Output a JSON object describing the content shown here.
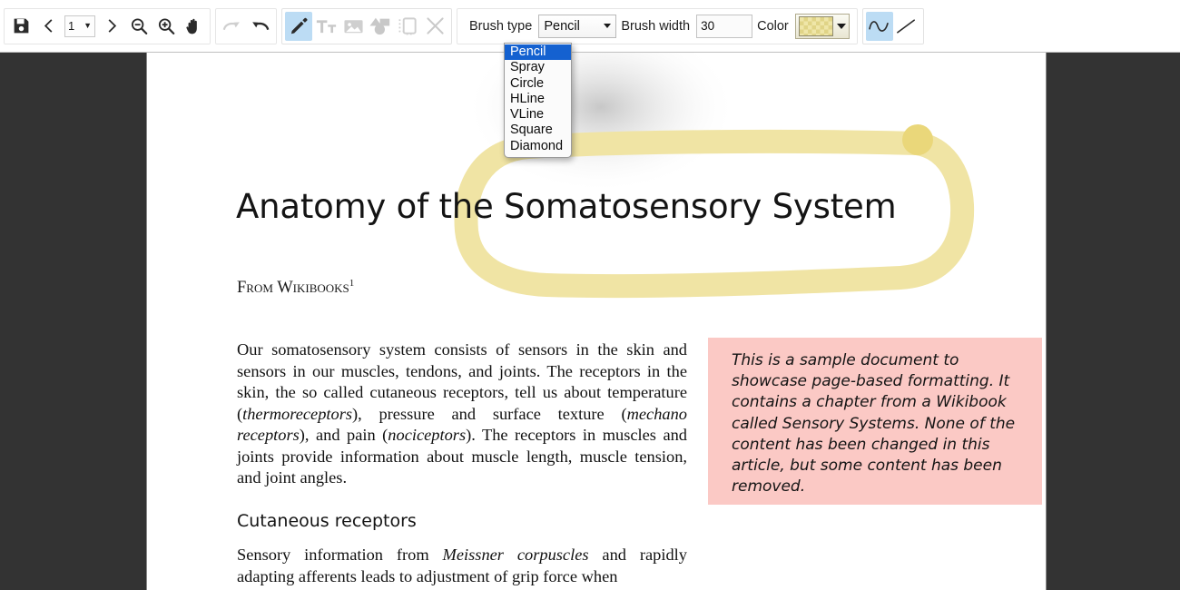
{
  "toolbar": {
    "nav_group": {
      "save_label": "Save",
      "prev_label": "Previous page",
      "page_value": "1",
      "next_label": "Next page",
      "zoom_out_label": "Zoom out",
      "zoom_in_label": "Zoom in",
      "pan_label": "Pan"
    },
    "history_group": {
      "redo_label": "Redo",
      "undo_label": "Undo"
    },
    "tools_group": {
      "pencil_label": "Pencil",
      "text_label": "Text",
      "image_label": "Image",
      "shapes_label": "Shapes",
      "stamp_label": "Stamp",
      "delete_label": "Delete"
    },
    "brush_type_label": "Brush type",
    "brush_type_value": "Pencil",
    "brush_width_label": "Brush width",
    "brush_width_value": "30",
    "color_label": "Color",
    "color_value": "#efe6a8",
    "style_group": {
      "curve_label": "Curve",
      "line_label": "Line"
    }
  },
  "brush_menu": {
    "open": true,
    "selected": "Pencil",
    "options": [
      "Pencil",
      "Spray",
      "Circle",
      "HLine",
      "VLine",
      "Square",
      "Diamond"
    ]
  },
  "document": {
    "title": "Anatomy of the Somatosensory System",
    "source_line": "From Wikibooks",
    "source_footnote": "1",
    "paragraph1_html": "Our somatosensory system consists of sensors in the skin and sensors in our muscles, tendons, and joints. The receptors in the skin, the so called cutaneous receptors, tell us about temperature (<i>thermoreceptors</i>), pressure and surface texture (<i>mechano receptors</i>), and pain (<i>nociceptors</i>). The receptors in muscles and joints provide information about muscle length, muscle tension, and joint angles.",
    "section_heading": "Cutaneous receptors",
    "paragraph2_html": "Sensory information from <i>Meissner corpuscles</i> and rapidly adapting afferents leads to adjustment of grip force when",
    "note_box_text": "This is a sample document to showcase page-based formatting. It contains a chapter from a Wikibook called Sensory Systems. None of the content has been changed in this article, but some content has been removed.",
    "note_box_color": "#fbc9c5"
  },
  "annotation": {
    "type": "highlighter-loop",
    "stroke_color": "#f0e4a4",
    "dot_color": "#e8d675"
  },
  "colors": {
    "canvas_background": "#333333",
    "page_background": "#ffffff",
    "toolbar_background": "#ffffff",
    "active_tool_highlight": "#bcdcf4",
    "menu_selected": "#1461d0"
  }
}
